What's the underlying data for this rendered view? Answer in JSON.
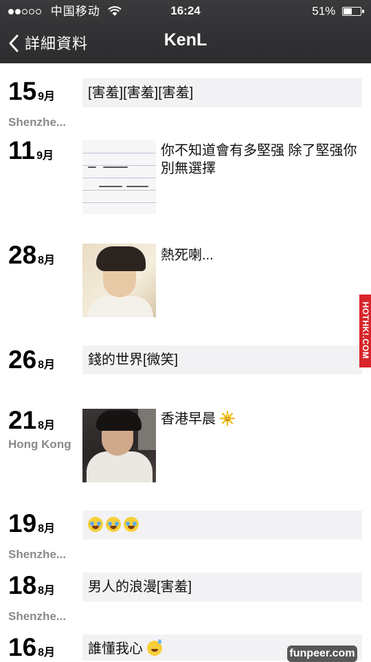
{
  "status_bar": {
    "carrier": "中国移动",
    "time": "16:24",
    "battery_percent": "51%",
    "battery_level": 0.51,
    "signal_bars_filled": 2,
    "signal_bars_total": 5
  },
  "nav": {
    "back_label": "詳細資料",
    "title": "KenL"
  },
  "posts": [
    {
      "day": "15",
      "month": "9月",
      "location": "Shenzhe...",
      "text": "[害羞][害羞][害羞]"
    },
    {
      "day": "11",
      "month": "9月",
      "location": "",
      "text": "你不知道會有多堅强 除了堅强你別無選擇",
      "thumb": "handwriting-photo"
    },
    {
      "day": "28",
      "month": "8月",
      "location": "",
      "text": "熱死喇...",
      "thumb": "selfie-photo"
    },
    {
      "day": "26",
      "month": "8月",
      "location": "",
      "text": "錢的世界[微笑]"
    },
    {
      "day": "21",
      "month": "8月",
      "location": "Hong Kong",
      "text": "香港早晨",
      "thumb": "car-selfie-photo",
      "icon": "sun-emoji-icon"
    },
    {
      "day": "19",
      "month": "8月",
      "location": "Shenzhe...",
      "text": "",
      "icon": "tears-of-joy-emoji-icon"
    },
    {
      "day": "18",
      "month": "8月",
      "location": "Shenzhe...",
      "text": "男人的浪漫[害羞]"
    },
    {
      "day": "16",
      "month": "8月",
      "location": "",
      "text": "誰懂我心",
      "icon": "sweat-smile-emoji-icon"
    }
  ],
  "watermarks": {
    "side": "HOTHK!.COM",
    "bottom": "funpeer.com"
  },
  "colors": {
    "header_bg": "#2c2c2e",
    "post_bg": "#f2f2f4",
    "location_text": "#8a8a8a",
    "side_watermark": "#d8262b"
  }
}
